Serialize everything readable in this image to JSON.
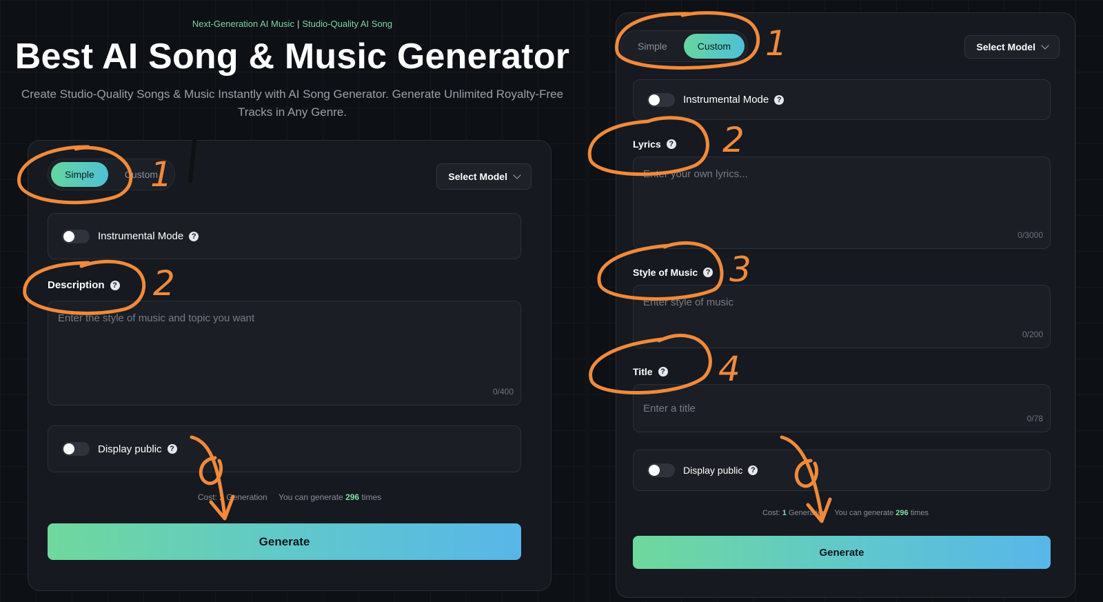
{
  "hero": {
    "tagline_left": "Next-Generation AI Music",
    "tagline_sep": "|",
    "tagline_right": "Studio-Quality AI Song",
    "title": "Best AI Song & Music Generator",
    "subtitle": "Create Studio-Quality Songs & Music Instantly with AI Song Generator. Generate Unlimited Royalty-Free Tracks in Any Genre."
  },
  "left_form": {
    "tabs": [
      {
        "label": "Simple",
        "active": true
      },
      {
        "label": "Custom",
        "active": false
      }
    ],
    "select_model": "Select Model",
    "instrumental_mode": "Instrumental Mode",
    "description_label": "Description",
    "description_placeholder": "Enter the style of music and topic you want",
    "description_counter": "0/400",
    "display_public": "Display public",
    "cost_label": "Cost:",
    "cost_value": "1",
    "cost_unit": "Generation",
    "can_generate_prefix": "You can generate",
    "can_generate_value": "296",
    "can_generate_suffix": "times",
    "generate": "Generate"
  },
  "right_form": {
    "tabs": [
      {
        "label": "Simple",
        "active": false
      },
      {
        "label": "Custom",
        "active": true
      }
    ],
    "select_model": "Select Model",
    "instrumental_mode": "Instrumental Mode",
    "lyrics_label": "Lyrics",
    "lyrics_placeholder": "Enter your own lyrics...",
    "lyrics_counter": "0/3000",
    "style_label": "Style of Music",
    "style_placeholder": "Enter style of music",
    "style_counter": "0/200",
    "title_label": "Title",
    "title_placeholder": "Enter a title",
    "title_counter": "0/78",
    "display_public": "Display public",
    "cost_label": "Cost:",
    "cost_value": "1",
    "cost_unit": "Generation",
    "can_generate_prefix": "You can generate",
    "can_generate_value": "296",
    "can_generate_suffix": "times",
    "generate": "Generate"
  },
  "annotations": {
    "color": "#f08a3c",
    "left_numbers": [
      "1",
      "2"
    ],
    "right_numbers": [
      "1",
      "2",
      "3",
      "4"
    ]
  },
  "colors": {
    "accent_start": "#6fd89c",
    "accent_end": "#58b6e8",
    "background": "#0d1014",
    "card": "#16191f"
  }
}
